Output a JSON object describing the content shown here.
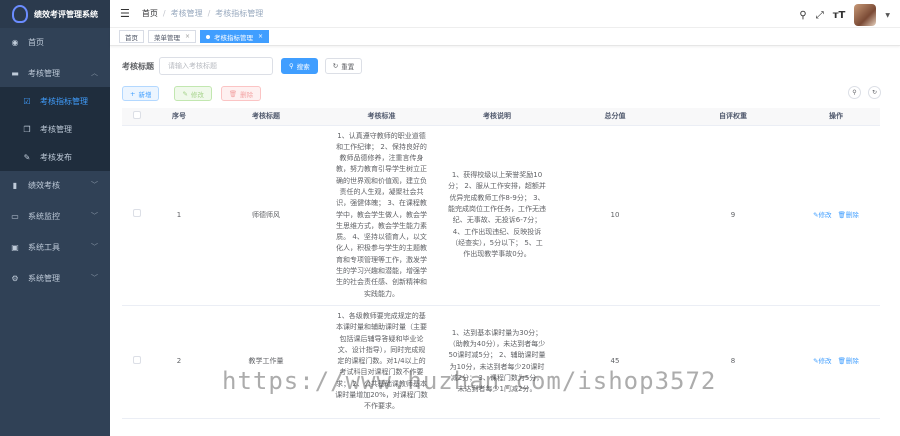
{
  "app": {
    "title": "绩效考评管理系统"
  },
  "sidebar": {
    "items": [
      {
        "label": "首页",
        "icon": "dashboard-icon"
      },
      {
        "label": "考核管理",
        "icon": "folder-icon",
        "expanded": true,
        "children": [
          {
            "label": "考核指标管理",
            "icon": "checklist-icon",
            "active": true
          },
          {
            "label": "考核管理",
            "icon": "copy-icon"
          },
          {
            "label": "考核发布",
            "icon": "edit-icon"
          }
        ]
      },
      {
        "label": "绩效考核",
        "icon": "chart-icon"
      },
      {
        "label": "系统监控",
        "icon": "monitor-icon"
      },
      {
        "label": "系统工具",
        "icon": "toolbox-icon"
      },
      {
        "label": "系统管理",
        "icon": "gear-icon"
      }
    ]
  },
  "breadcrumb": [
    "首页",
    "考核管理",
    "考核指标管理"
  ],
  "tags": [
    {
      "label": "首页"
    },
    {
      "label": "菜单管理"
    },
    {
      "label": "考核指标管理",
      "active": true
    }
  ],
  "search": {
    "label": "考核标题",
    "placeholder": "请输入考核标题",
    "search_button": "搜索",
    "reset_button": "重置"
  },
  "toolbar": {
    "add": "新增",
    "edit": "修改",
    "delete": "删除"
  },
  "table": {
    "headers": [
      "序号",
      "考核标题",
      "考核标准",
      "考核说明",
      "总分值",
      "自评权重",
      "操作"
    ],
    "rows": [
      {
        "index": "1",
        "title": "师德师风",
        "standard": "1、认真遵守教师的职业道德和工作纪律； 2、保持良好的教师品德修养，注重言传身教，努力教育引导学生树立正确的世界观和价值观，建立负责任的人生观，凝聚社会共识，强健体魄； 3、在课程教学中，教会学生做人，教会学生思维方式，教会学生能力素质。 4、坚持以德育人，以文化人，积极参与学生的主题教育和专项管理等工作，激发学生的学习兴趣和潜能，增强学生的社会责任感、创新精神和实践能力。",
        "description": "1、获得校级以上荣誉奖励10分； 2、服从工作安排，超额并优异完成教师工作8-9分； 3、能完成岗位工作任务，工作无违纪、无事故、无投诉6-7分； 4、工作出现违纪、反映投诉（经查实），5分以下； 5、工作出现教学事故0分。",
        "score": "10",
        "weight": "9",
        "edit": "修改",
        "delete": "删除"
      },
      {
        "index": "2",
        "title": "教学工作量",
        "standard": "1、各级教师要完成规定的基本课时量和辅助课时量（主要包括课后辅导答疑和毕业论文、设计指导），同时完成规定的课程门数。对1/4以上的考试科目对课程门数不作要求； 2、公共基础课教师基本课时量增加20%，对课程门数不作要求。",
        "description": "1、达到基本课时量为30分；（助教为40分），未达到者每少50课时减5分； 2、辅助课时量为10分，未达到者每少20课时减2分； 3、课程门数为5分，未达到者每少1门减2分。",
        "score": "45",
        "weight": "8",
        "edit": "修改",
        "delete": "删除"
      }
    ]
  },
  "watermark": "https://www.huzhan.com/ishop3572",
  "colors": {
    "sidebar_bg": "#304156",
    "accent": "#409eff"
  }
}
